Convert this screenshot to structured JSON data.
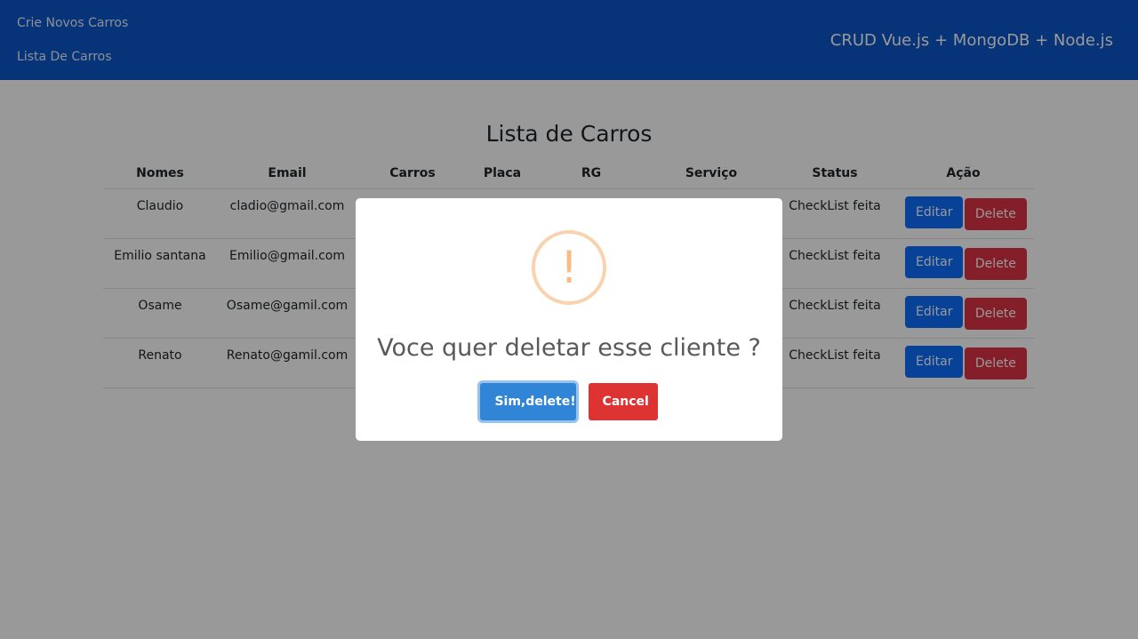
{
  "nav": {
    "links": [
      "Crie Novos Carros",
      "Lista De Carros"
    ],
    "brand": "CRUD Vue.js + MongoDB + Node.js"
  },
  "page": {
    "title": "Lista de Carros"
  },
  "table": {
    "headers": [
      "Nomes",
      "Email",
      "Carros",
      "Placa",
      "RG",
      "Serviço",
      "Status",
      "Ação"
    ],
    "rows": [
      {
        "nome": "Claudio",
        "email": "cladio@gmail.com",
        "status": "CheckList feita"
      },
      {
        "nome": "Emilio santana",
        "email": "Emilio@gmail.com",
        "status": "CheckList feita"
      },
      {
        "nome": "Osame",
        "email": "Osame@gamil.com",
        "status": "CheckList feita"
      },
      {
        "nome": "Renato",
        "email": "Renato@gamil.com",
        "status": "CheckList feita"
      }
    ],
    "edit_label": "Editar",
    "delete_label": "Delete"
  },
  "modal": {
    "icon": "!",
    "title": "Voce quer deletar esse cliente ?",
    "confirm_label": "Sim,delete!",
    "cancel_label": "Cancel"
  },
  "colors": {
    "navbar": "#0d55c8",
    "edit": "#0d6efd",
    "delete": "#dc3545",
    "confirm": "#3085d6",
    "cancel": "#dd3333",
    "warning": "#f8bb86"
  }
}
